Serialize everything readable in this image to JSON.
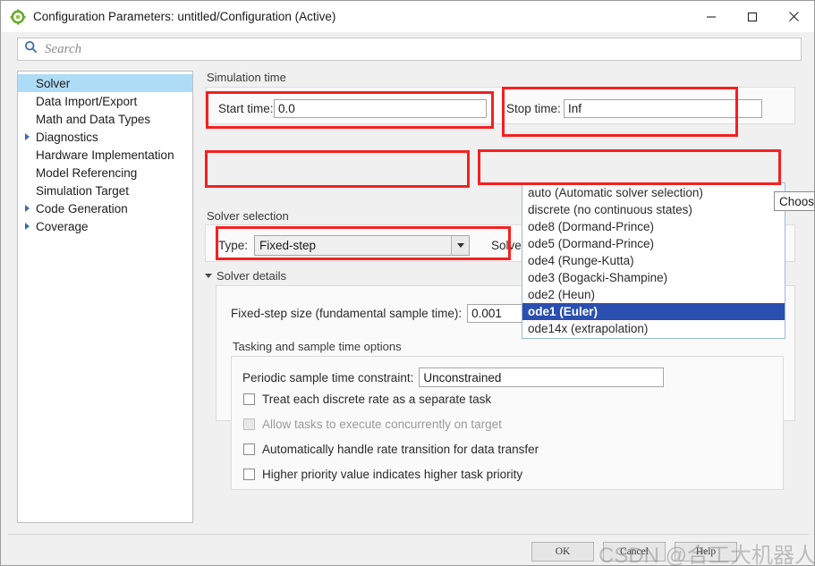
{
  "window": {
    "title": "Configuration Parameters: untitled/Configuration (Active)",
    "app_icon": "simulink-gear-icon",
    "minimize_label": "—",
    "maximize_label": "□",
    "close_label": "✕"
  },
  "search": {
    "placeholder": "Search",
    "value": "",
    "icon": "search-icon"
  },
  "sidebar": {
    "items": [
      {
        "label": "Solver",
        "expandable": false,
        "selected": true
      },
      {
        "label": "Data Import/Export",
        "expandable": false,
        "selected": false
      },
      {
        "label": "Math and Data Types",
        "expandable": false,
        "selected": false
      },
      {
        "label": "Diagnostics",
        "expandable": true,
        "selected": false
      },
      {
        "label": "Hardware Implementation",
        "expandable": false,
        "selected": false
      },
      {
        "label": "Model Referencing",
        "expandable": false,
        "selected": false
      },
      {
        "label": "Simulation Target",
        "expandable": false,
        "selected": false
      },
      {
        "label": "Code Generation",
        "expandable": true,
        "selected": false
      },
      {
        "label": "Coverage",
        "expandable": true,
        "selected": false
      }
    ]
  },
  "simulation_time": {
    "group_title": "Simulation time",
    "start_label": "Start time:",
    "start_value": "0.0",
    "stop_label": "Stop time:",
    "stop_value": "Inf"
  },
  "solver_selection": {
    "group_title": "Solver selection",
    "type_label": "Type:",
    "type_value": "Fixed-step",
    "solver_label": "Solver:",
    "solver_value": "ode1 (Euler)"
  },
  "solver_details": {
    "header": "Solver details",
    "fixed_step_label": "Fixed-step size (fundamental sample time):",
    "fixed_step_value": "0.001",
    "tasking_title": "Tasking and sample time options",
    "periodic_label": "Periodic sample time constraint:",
    "periodic_value": "Unconstrained",
    "checkboxes": [
      {
        "label": "Treat each discrete rate as a separate task",
        "checked": false,
        "disabled": false
      },
      {
        "label": "Allow tasks to execute concurrently on target",
        "checked": false,
        "disabled": true
      },
      {
        "label": "Automatically handle rate transition for data transfer",
        "checked": false,
        "disabled": false
      },
      {
        "label": "Higher priority value indicates higher task priority",
        "checked": false,
        "disabled": false
      }
    ]
  },
  "solver_dropdown": {
    "options": [
      "auto (Automatic solver selection)",
      "discrete (no continuous states)",
      "ode8 (Dormand-Prince)",
      "ode5 (Dormand-Prince)",
      "ode4 (Runge-Kutta)",
      "ode3 (Bogacki-Shampine)",
      "ode2 (Heun)",
      "ode1 (Euler)",
      "ode14x (extrapolation)"
    ],
    "selected_index": 7
  },
  "tooltip": {
    "text": "Choose..."
  },
  "footer": {
    "ok_label": "OK",
    "cancel_label": "Cancel",
    "help_label": "Help"
  },
  "watermark": {
    "text": "CSDN @合工大机器人实验室"
  },
  "colors": {
    "annotation_red": "#f42020",
    "selection_blue": "#aedcf7",
    "dropdown_highlight": "#2a4fb0",
    "focus_border": "#2a6fc4"
  }
}
